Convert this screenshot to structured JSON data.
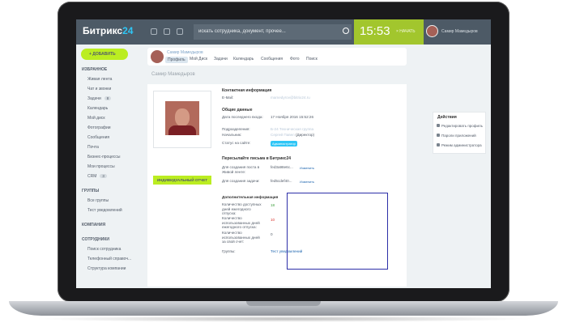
{
  "topbar": {
    "logo": "Битрикс",
    "logo_num": "24",
    "search_placeholder": "искать сотрудника, документ, прочее...",
    "clock_time": "15:53",
    "clock_button": "× НАЧАТЬ",
    "user_name": "Самир Мамедыров",
    "colors": {
      "bar": "#4d5a66",
      "clock": "#a2c62d",
      "accent": "#bbed21"
    }
  },
  "sidebar": {
    "add_button": "+ ДОБАВИТЬ",
    "favorites_heading": "ИЗБРАННОЕ",
    "favorites": [
      {
        "label": "Живая лента"
      },
      {
        "label": "Чат и звонки"
      },
      {
        "label": "Задачи",
        "badge": "8"
      },
      {
        "label": "Календарь"
      },
      {
        "label": "Мой диск"
      },
      {
        "label": "Фотографии"
      },
      {
        "label": "Сообщения"
      },
      {
        "label": "Почта"
      },
      {
        "label": "Бизнес-процессы"
      },
      {
        "label": "Мои процессы"
      },
      {
        "label": "CRM",
        "badge": "3"
      }
    ],
    "groups_heading": "ГРУППЫ",
    "groups": [
      {
        "label": "Все группы"
      },
      {
        "label": "Тест уведомлений"
      }
    ],
    "company_heading": "КОМПАНИЯ",
    "employees_heading": "СОТРУДНИКИ",
    "employees": [
      {
        "label": "Поиск сотрудника"
      },
      {
        "label": "Телефонный справоч..."
      },
      {
        "label": "Структура компании"
      }
    ]
  },
  "profile_bar": {
    "name": "Самир Мамедыров",
    "tabs": [
      "Профиль",
      "Мой Диск",
      "Задачи",
      "Календарь",
      "Сообщения",
      "Фото",
      "Поиск"
    ]
  },
  "page_title": "Самир Мамедыров",
  "report_button": "ИНДИВИДУАЛЬНЫЙ ОТЧЕТ",
  "contact": {
    "heading": "Контактная информация",
    "email_label": "E-Mail:",
    "email_value": "mamedyrov@bitrix24.ru"
  },
  "general": {
    "heading": "Общие данные",
    "last_login_label": "Дата последнего входа:",
    "last_login_value": "17 Ноября 2016 15:52:26",
    "department_label": "Подразделения:",
    "department_value": "Б-24 Техническая группа",
    "manager_label": "Начальник:",
    "manager_value": "Сергей Павел",
    "manager_suffix": "(Директор)",
    "status_label": "Статус на сайте:",
    "status_value": "Администратор"
  },
  "forward": {
    "heading": "Пересылайте письма в Битрикс24",
    "posts_label": "Для создания поста в Живой ленте:",
    "posts_value": "fed3a98e6c...",
    "tasks_label": "Для создания задачи:",
    "tasks_value": "fed5cdef40...",
    "change_link": "Изменить"
  },
  "extra": {
    "heading": "Дополнительная информация",
    "rows": [
      {
        "label": "Количество доступных дней ежегодного отпуска:",
        "value": "18",
        "color": "#3b9e3b"
      },
      {
        "label": "Количество использованных дней ежегодного отпуска:",
        "value": "10",
        "color": "#d9332e"
      },
      {
        "label": "Количество использованных дней за свой счет:",
        "value": "0",
        "color": "#535c69"
      },
      {
        "label": "Группы:",
        "value": "Тест уведомлений",
        "color": "#2067b0"
      }
    ]
  },
  "actions": {
    "heading": "Действия",
    "items": [
      "Редактировать профиль",
      "Пароли приложений",
      "Режим администратора"
    ]
  }
}
